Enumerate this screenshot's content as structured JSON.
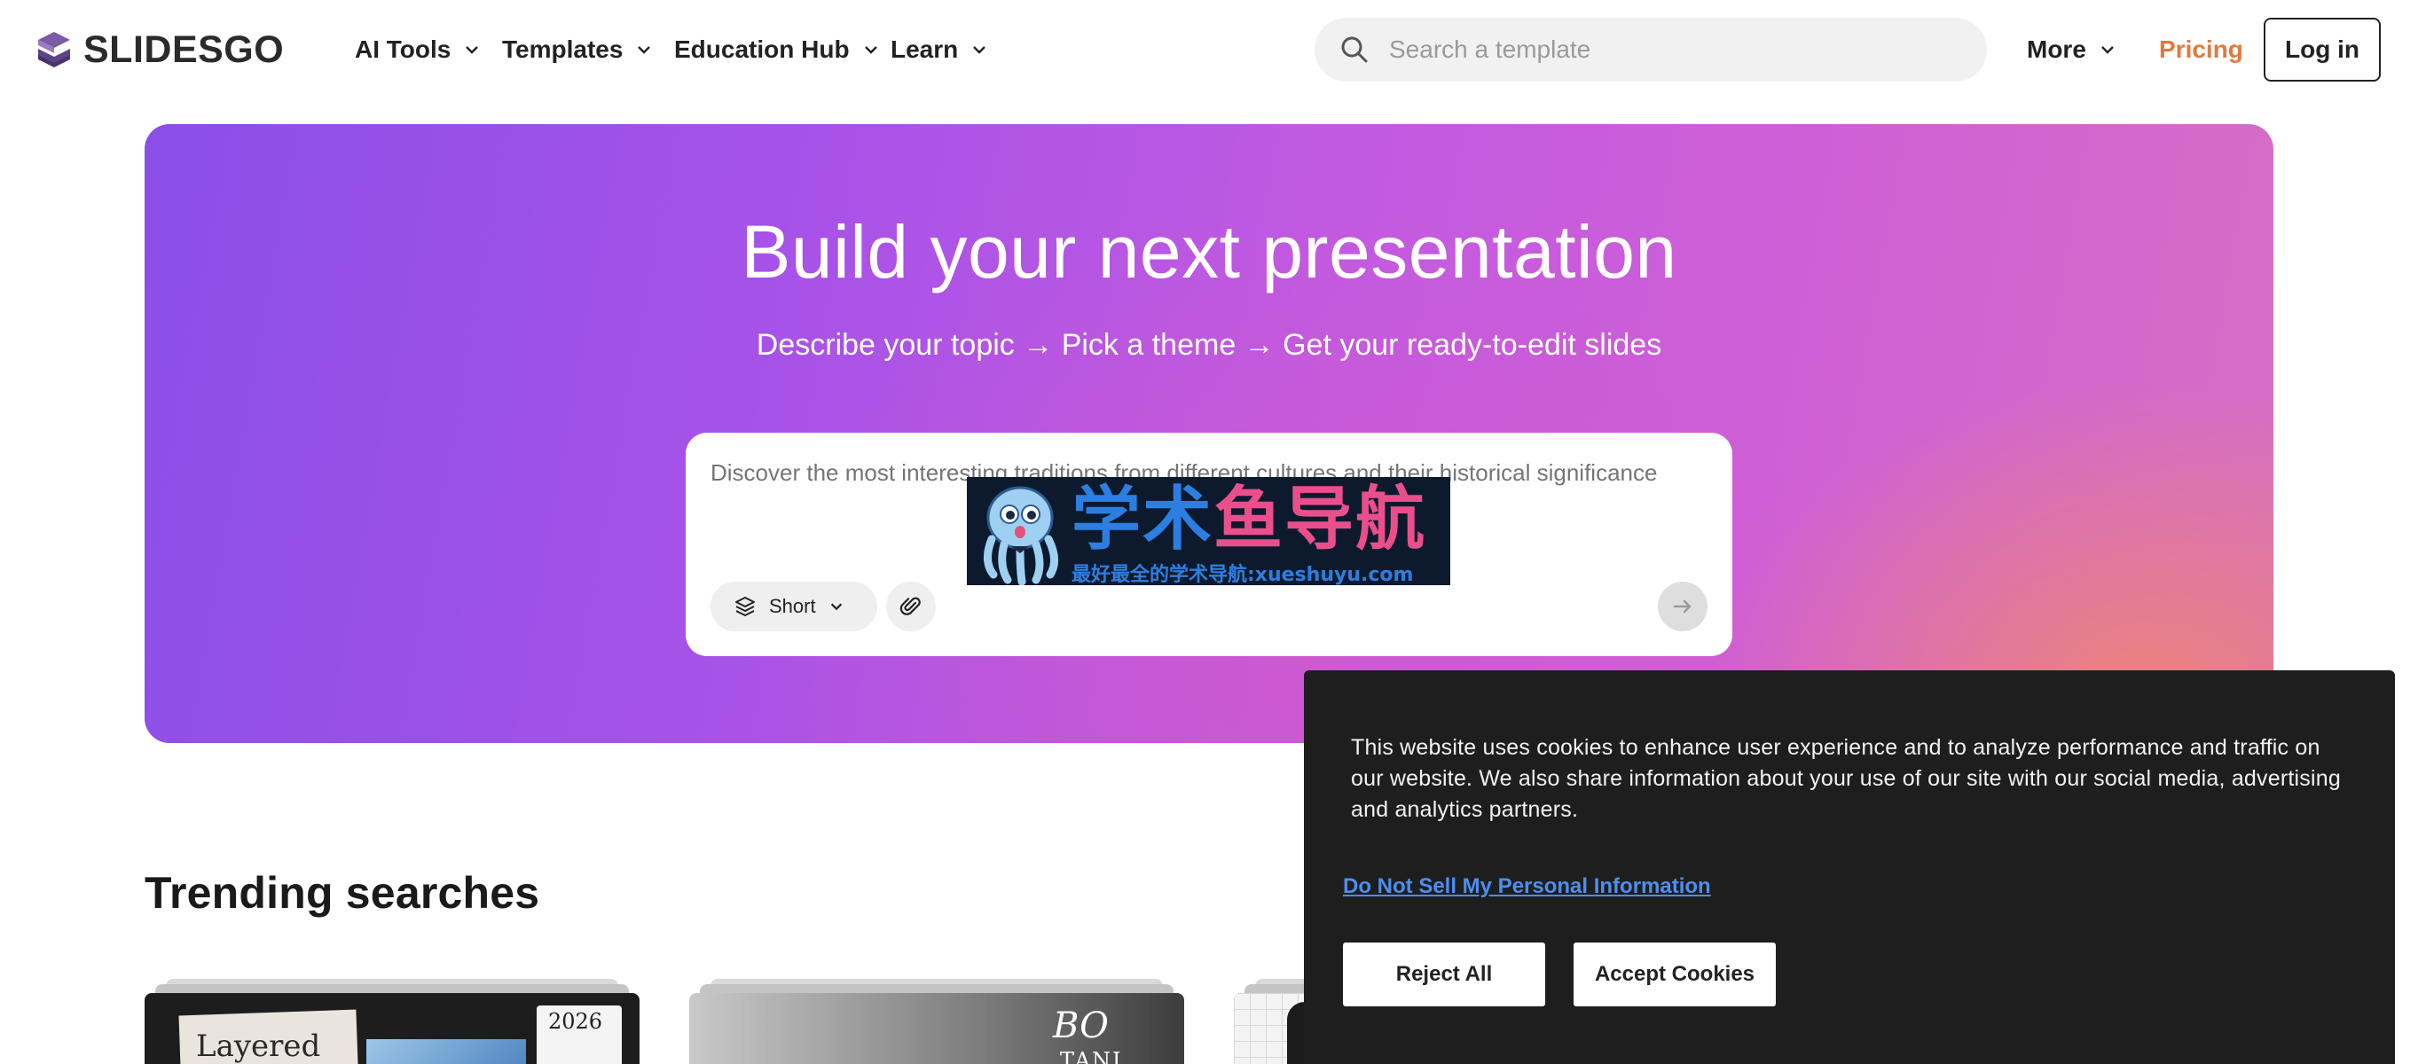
{
  "header": {
    "logo_text": "SLIDESGO",
    "nav": [
      {
        "label": "AI Tools"
      },
      {
        "label": "Templates"
      },
      {
        "label": "Education Hub"
      },
      {
        "label": "Learn"
      }
    ],
    "search_placeholder": "Search a template",
    "more_label": "More",
    "pricing_label": "Pricing",
    "login_label": "Log in",
    "colors": {
      "pricing": "#e07a3f"
    }
  },
  "hero": {
    "title": "Build your next presentation",
    "subtitle": "Describe your topic → Pick a theme → Get your ready-to-edit slides",
    "prompt_placeholder": "Discover the most interesting traditions from different cultures and their historical significance",
    "length_option": "Short"
  },
  "watermark": {
    "title_part1": "学术",
    "title_part2": "鱼导航",
    "line": "最好最全的学术导航:xueshuyu.com"
  },
  "trending": {
    "title": "Trending searches",
    "cards": [
      {
        "thumb_text": "Layered",
        "thumb_badge": "2026"
      },
      {
        "thumb_text": "BO",
        "thumb_sub": "TANI"
      },
      {},
      {}
    ]
  },
  "cookie_banner": {
    "text": "This website uses cookies to enhance user experience and to analyze performance and traffic on our website. We also share information about your use of our site with our social media, advertising and analytics partners.",
    "link_label": "Do Not Sell My Personal Information",
    "reject_label": "Reject All",
    "accept_label": "Accept Cookies"
  }
}
